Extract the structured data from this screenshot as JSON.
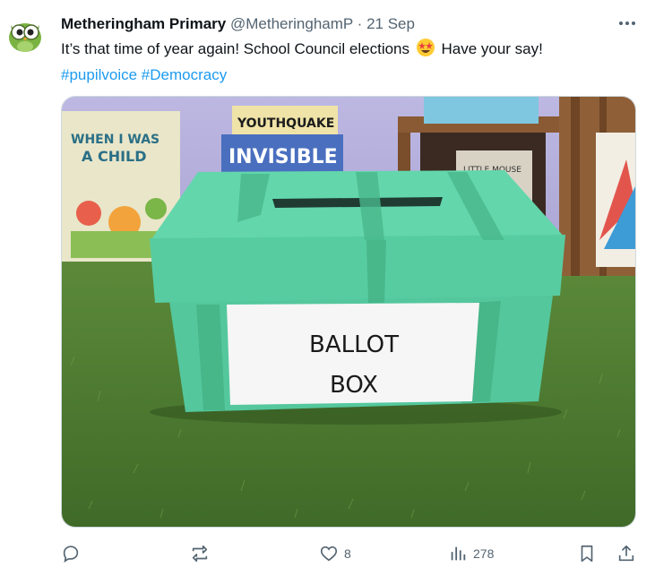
{
  "tweet": {
    "author_name": "Metheringham Primary",
    "handle": "@MetheringhamP",
    "separator": "·",
    "date": "21 Sep",
    "text_part1": "It’s that time of year again! School Council elections",
    "emoji": "star-struck-emoji",
    "text_part2": "Have your say!",
    "hashtags": [
      "#pupilvoice",
      "#Democracy"
    ]
  },
  "media": {
    "box_label_line1": "BALLOT",
    "box_label_line2": "BOX",
    "book_titles": [
      "WHEN I WAS A CHILD",
      "YOUTHQUAKE",
      "The INVISIBLE",
      "LITTLE MOUSE"
    ],
    "colors": {
      "box": "#5fd3a8",
      "grass": "#4f7a33",
      "wall": "#b7b3dd"
    }
  },
  "actions": {
    "reply_icon": "reply-icon",
    "retweet_icon": "retweet-icon",
    "like_icon": "heart-icon",
    "like_count": "8",
    "views_icon": "views-icon",
    "views_count": "278",
    "bookmark_icon": "bookmark-icon",
    "share_icon": "share-icon"
  }
}
